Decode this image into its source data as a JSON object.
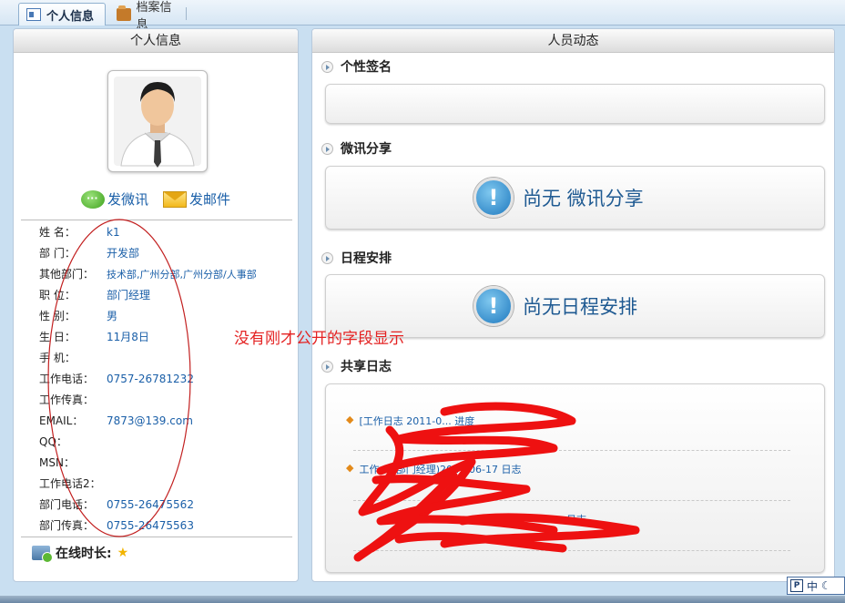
{
  "tabs": [
    {
      "label": "个人信息",
      "icon": "id-card-icon",
      "active": true
    },
    {
      "label": "档案信息",
      "icon": "folder-icon",
      "active": false
    }
  ],
  "left_panel": {
    "title": "个人信息",
    "actions": {
      "weibo": "发微讯",
      "email": "发邮件"
    },
    "fields": [
      {
        "label": "姓  名：",
        "value": "k1"
      },
      {
        "label": "部  门：",
        "value": "开发部"
      },
      {
        "label": "其他部门：",
        "value": "技术部,广州分部,广州分部/人事部"
      },
      {
        "label": "职  位：",
        "value": "部门经理"
      },
      {
        "label": "性  别：",
        "value": "男"
      },
      {
        "label": "生  日：",
        "value": "11月8日"
      },
      {
        "label": "手  机：",
        "value": ""
      },
      {
        "label": "工作电话：",
        "value": "0757-26781232"
      },
      {
        "label": "工作传真：",
        "value": ""
      },
      {
        "label": "EMAIL：",
        "value": "7873@139.com"
      },
      {
        "label": "QQ：",
        "value": ""
      },
      {
        "label": "MSN：",
        "value": ""
      },
      {
        "label": "工作电话2：",
        "value": ""
      },
      {
        "label": "部门电话：",
        "value": "0755-26475562"
      },
      {
        "label": "部门传真：",
        "value": "0755-26475563"
      }
    ],
    "online_label": "在线时长:"
  },
  "right_panel": {
    "title": "人员动态",
    "sections": {
      "signature": {
        "title": "个性签名"
      },
      "weibo": {
        "title": "微讯分享",
        "empty": "尚无 微讯分享"
      },
      "schedule": {
        "title": "日程安排",
        "empty": "尚无日程安排"
      },
      "log": {
        "title": "共享日志",
        "items": [
          "[工作日志 2011-0... 进度",
          "工作... (部门经理)2011-06-17 日志",
          "... 日志"
        ]
      }
    }
  },
  "annotation": {
    "text": "没有刚才公开的字段显示",
    "color": "#e42222"
  },
  "ime": {
    "label": "中"
  },
  "colors": {
    "link": "#1a5fa8",
    "accent": "#1f5a92",
    "annotation": "#e42222"
  }
}
